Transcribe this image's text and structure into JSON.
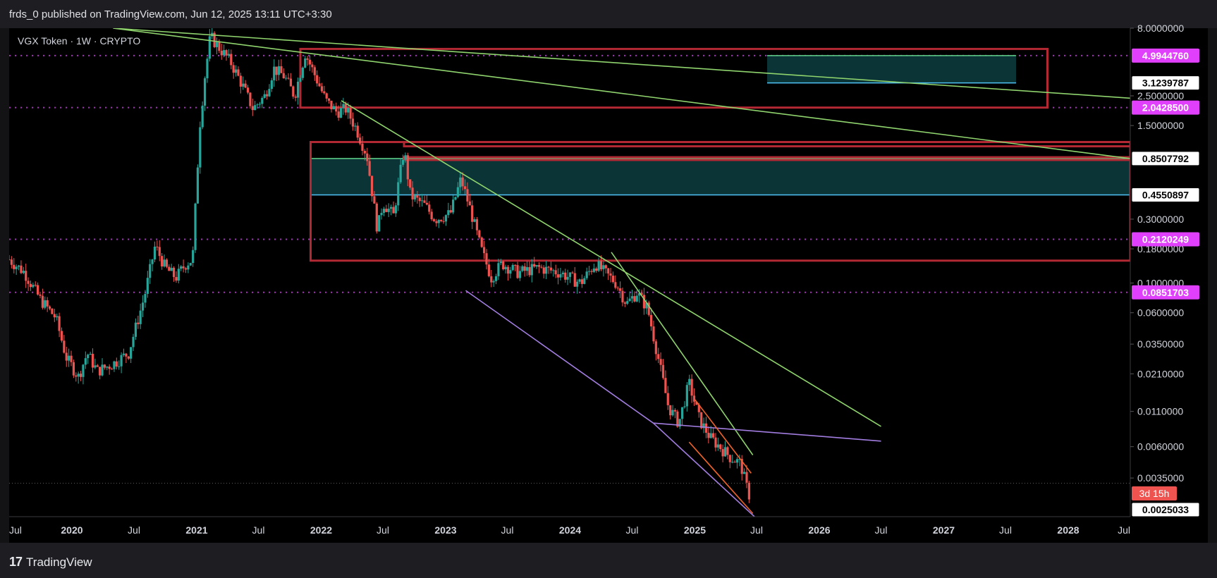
{
  "header": {
    "published_text": "frds_0 published on TradingView.com, Jun 12, 2025 13:11 UTC+3:30"
  },
  "footer": {
    "brand": "TradingView",
    "logo_icon": "tradingview-logo-icon"
  },
  "symbol": {
    "label": "VGX Token · 1W · CRYPTO"
  },
  "colors": {
    "background": "#000000",
    "up": "#26a69a",
    "down": "#ef5350",
    "zone_border": "#b22833",
    "zone_fill": "#0c3a3c",
    "trendline_green": "#8fd46d",
    "trendline_purple": "#a27de0",
    "trendline_orange": "#f0642a",
    "level_magenta": "#e040fb"
  },
  "chart_data": {
    "type": "candlestick",
    "title": "VGX Token · 1W · CRYPTO",
    "xlabel": "",
    "ylabel": "",
    "x_ticks": [
      "Jul",
      "2020",
      "Jul",
      "2021",
      "Jul",
      "2022",
      "Jul",
      "2023",
      "Jul",
      "2024",
      "Jul",
      "2025",
      "Jul",
      "2026",
      "Jul",
      "2027",
      "Jul",
      "2028",
      "Jul"
    ],
    "y_ticks": [
      "8.0000000",
      "2.5000000",
      "1.5000000",
      "0.3000000",
      "0.1800000",
      "0.1000000",
      "0.0600000",
      "0.0350000",
      "0.0210000",
      "0.0110000",
      "0.0060000",
      "0.0035000"
    ],
    "y_scale": "log",
    "ylim": [
      0.0018,
      8.0
    ],
    "xlim": [
      "2019-07-01",
      "2028-07-01"
    ],
    "price_tags": [
      {
        "value": "4.9944760",
        "style": "magenta"
      },
      {
        "value": "3.1239787",
        "style": "white"
      },
      {
        "value": "2.0428500",
        "style": "magenta"
      },
      {
        "value": "0.8507792",
        "style": "white"
      },
      {
        "value": "0.4550897",
        "style": "white"
      },
      {
        "value": "0.2120249",
        "style": "magenta"
      },
      {
        "value": "0.0851703",
        "style": "magenta"
      },
      {
        "value": "0.0025033",
        "style": "white"
      }
    ],
    "countdown": "3d 15h",
    "horizontal_levels": [
      4.994476,
      2.04285,
      0.2120249,
      0.0851703
    ],
    "zones": [
      {
        "from": "2021-11-01",
        "to": "2027-11-01",
        "low": 2.04285,
        "high": 5.6
      },
      {
        "from": "2021-12-01",
        "to": "2028-07-01",
        "low": 0.147,
        "high": 1.13
      },
      {
        "from": "2022-09-01",
        "to": "2028-07-01",
        "low": 1.05,
        "high": 1.13
      },
      {
        "from": "2022-09-01",
        "to": "2028-07-01",
        "low": 0.83,
        "high": 0.87
      }
    ],
    "shaded_ranges": [
      {
        "from": "2025-08-01",
        "to": "2027-08-01",
        "low": 3.1239787,
        "high": 4.994476
      },
      {
        "from": "2021-12-01",
        "to": "2028-07-01",
        "low": 0.4550897,
        "high": 0.8507792
      }
    ],
    "trendlines": [
      {
        "color": "green",
        "points": [
          [
            "2020-05-01",
            8.0
          ],
          [
            "2028-07-01",
            2.4
          ]
        ]
      },
      {
        "color": "green",
        "points": [
          [
            "2020-05-01",
            8.0
          ],
          [
            "2028-07-01",
            0.8507792
          ]
        ]
      },
      {
        "color": "green",
        "points": [
          [
            "2022-03-01",
            2.3
          ],
          [
            "2026-07-01",
            0.0085
          ]
        ]
      },
      {
        "color": "green",
        "points": [
          [
            "2024-05-01",
            0.17
          ],
          [
            "2025-06-20",
            0.0052
          ]
        ]
      },
      {
        "color": "purple",
        "points": [
          [
            "2023-03-01",
            0.088
          ],
          [
            "2024-09-01",
            0.009
          ],
          [
            "2026-07-01",
            0.0066
          ]
        ]
      },
      {
        "color": "purple",
        "points": [
          [
            "2024-09-01",
            0.009
          ],
          [
            "2025-06-25",
            0.0018
          ]
        ]
      },
      {
        "color": "orange",
        "points": [
          [
            "2025-01-01",
            0.0135
          ],
          [
            "2025-06-15",
            0.0038
          ]
        ]
      },
      {
        "color": "orange",
        "points": [
          [
            "2024-12-15",
            0.0065
          ],
          [
            "2025-06-20",
            0.0019
          ]
        ]
      }
    ],
    "price_path": [
      [
        "2019-07-01",
        0.15
      ],
      [
        "2019-08-15",
        0.12
      ],
      [
        "2019-10-01",
        0.075
      ],
      [
        "2019-11-15",
        0.055
      ],
      [
        "2019-12-15",
        0.028
      ],
      [
        "2020-01-20",
        0.02
      ],
      [
        "2020-02-15",
        0.03
      ],
      [
        "2020-03-15",
        0.022
      ],
      [
        "2020-05-01",
        0.025
      ],
      [
        "2020-06-15",
        0.03
      ],
      [
        "2020-08-01",
        0.08
      ],
      [
        "2020-09-01",
        0.19
      ],
      [
        "2020-10-01",
        0.13
      ],
      [
        "2020-11-01",
        0.11
      ],
      [
        "2020-12-01",
        0.14
      ],
      [
        "2020-12-20",
        0.15
      ],
      [
        "2021-01-10",
        1.5
      ],
      [
        "2021-01-25",
        3.5
      ],
      [
        "2021-02-10",
        7.0
      ],
      [
        "2021-03-01",
        6.0
      ],
      [
        "2021-04-10",
        4.5
      ],
      [
        "2021-05-15",
        3.0
      ],
      [
        "2021-06-15",
        2.0
      ],
      [
        "2021-07-20",
        2.5
      ],
      [
        "2021-08-15",
        4.0
      ],
      [
        "2021-09-15",
        3.5
      ],
      [
        "2021-10-15",
        2.5
      ],
      [
        "2021-11-15",
        5.2
      ],
      [
        "2021-12-15",
        3.5
      ],
      [
        "2022-01-15",
        2.3
      ],
      [
        "2022-02-15",
        1.9
      ],
      [
        "2022-03-15",
        2.0
      ],
      [
        "2022-04-15",
        1.4
      ],
      [
        "2022-05-15",
        0.9
      ],
      [
        "2022-06-15",
        0.25
      ],
      [
        "2022-07-01",
        0.4
      ],
      [
        "2022-08-01",
        0.32
      ],
      [
        "2022-09-01",
        1.0
      ],
      [
        "2022-09-20",
        0.45
      ],
      [
        "2022-11-01",
        0.38
      ],
      [
        "2022-12-01",
        0.3
      ],
      [
        "2023-01-15",
        0.33
      ],
      [
        "2023-02-15",
        0.6
      ],
      [
        "2023-03-15",
        0.35
      ],
      [
        "2023-04-15",
        0.18
      ],
      [
        "2023-05-15",
        0.11
      ],
      [
        "2023-06-15",
        0.14
      ],
      [
        "2023-08-01",
        0.12
      ],
      [
        "2023-10-01",
        0.13
      ],
      [
        "2023-12-01",
        0.12
      ],
      [
        "2024-02-01",
        0.1
      ],
      [
        "2024-03-15",
        0.14
      ],
      [
        "2024-05-15",
        0.1
      ],
      [
        "2024-06-15",
        0.07
      ],
      [
        "2024-07-15",
        0.085
      ],
      [
        "2024-08-15",
        0.065
      ],
      [
        "2024-09-15",
        0.028
      ],
      [
        "2024-10-15",
        0.012
      ],
      [
        "2024-11-15",
        0.009
      ],
      [
        "2024-12-15",
        0.018
      ],
      [
        "2025-01-15",
        0.0095
      ],
      [
        "2025-02-15",
        0.007
      ],
      [
        "2025-03-15",
        0.006
      ],
      [
        "2025-04-15",
        0.005
      ],
      [
        "2025-05-15",
        0.0045
      ],
      [
        "2025-06-05",
        0.0028
      ],
      [
        "2025-06-12",
        0.0025033
      ]
    ]
  }
}
